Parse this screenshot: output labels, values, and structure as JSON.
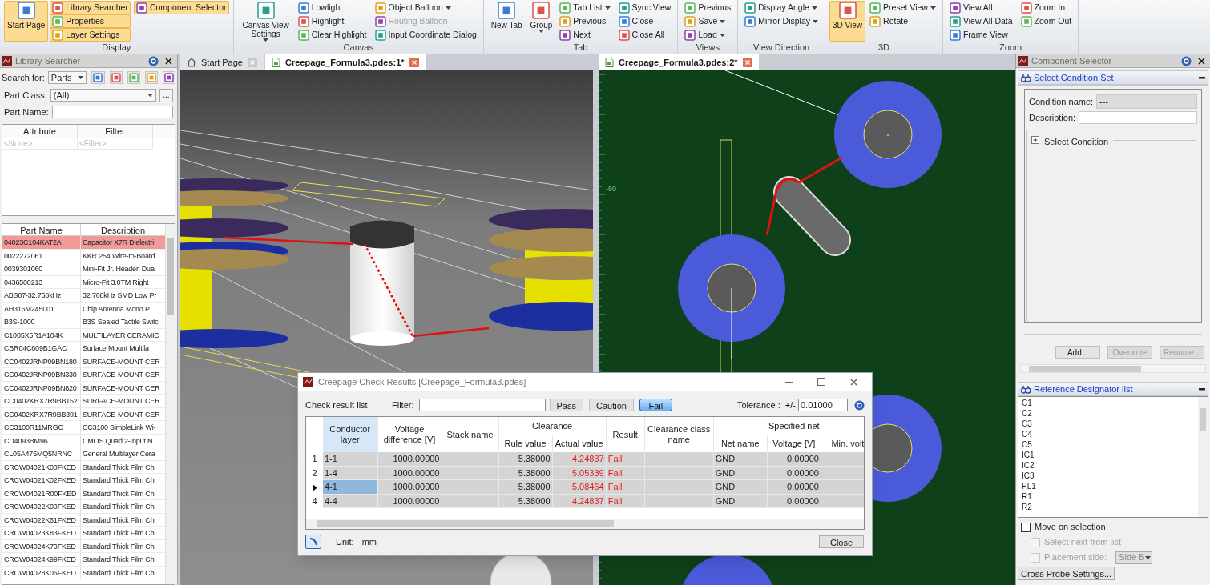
{
  "ribbon": {
    "groups": [
      {
        "label": "Display",
        "items": [
          {
            "label": "Start Page",
            "kind": "large",
            "on": true,
            "disabled": false,
            "dropdown": false
          },
          {
            "label": "Library Searcher",
            "kind": "small",
            "on": true,
            "disabled": false,
            "dropdown": false
          },
          {
            "label": "Properties",
            "kind": "small",
            "on": true,
            "disabled": false,
            "dropdown": false
          },
          {
            "label": "Layer Settings",
            "kind": "small",
            "on": true,
            "disabled": false,
            "dropdown": false
          },
          {
            "label": "Component Selector",
            "kind": "small",
            "on": true,
            "disabled": false,
            "dropdown": false
          }
        ]
      },
      {
        "label": "Canvas",
        "items": [
          {
            "label": "Canvas View Settings",
            "kind": "large",
            "on": false,
            "disabled": false,
            "dropdown": true
          },
          {
            "label": "Lowlight",
            "kind": "small",
            "on": false,
            "disabled": false,
            "dropdown": false
          },
          {
            "label": "Highlight",
            "kind": "small",
            "on": false,
            "disabled": false,
            "dropdown": false
          },
          {
            "label": "Clear Highlight",
            "kind": "small",
            "on": false,
            "disabled": false,
            "dropdown": false
          },
          {
            "label": "Object Balloon",
            "kind": "small",
            "on": false,
            "disabled": false,
            "dropdown": true
          },
          {
            "label": "Routing Balloon",
            "kind": "small",
            "on": false,
            "disabled": true,
            "dropdown": false
          },
          {
            "label": "Input Coordinate Dialog",
            "kind": "small",
            "on": false,
            "disabled": false,
            "dropdown": false
          }
        ]
      },
      {
        "label": "Tab",
        "items": [
          {
            "label": "New Tab",
            "kind": "large",
            "on": false,
            "disabled": false,
            "dropdown": false
          },
          {
            "label": "Group",
            "kind": "large",
            "on": false,
            "disabled": false,
            "dropdown": true
          },
          {
            "label": "Tab List",
            "kind": "small",
            "on": false,
            "disabled": false,
            "dropdown": true
          },
          {
            "label": "Previous",
            "kind": "small",
            "on": false,
            "disabled": false,
            "dropdown": false
          },
          {
            "label": "Next",
            "kind": "small",
            "on": false,
            "disabled": false,
            "dropdown": false
          },
          {
            "label": "Sync View",
            "kind": "small",
            "on": false,
            "disabled": false,
            "dropdown": false
          },
          {
            "label": "Close",
            "kind": "small",
            "on": false,
            "disabled": false,
            "dropdown": false
          },
          {
            "label": "Close All",
            "kind": "small",
            "on": false,
            "disabled": false,
            "dropdown": false
          }
        ]
      },
      {
        "label": "Views",
        "items": [
          {
            "label": "Previous",
            "kind": "small",
            "on": false,
            "disabled": false,
            "dropdown": false
          },
          {
            "label": "Save",
            "kind": "small",
            "on": false,
            "disabled": false,
            "dropdown": true
          },
          {
            "label": "Load",
            "kind": "small",
            "on": false,
            "disabled": false,
            "dropdown": true
          }
        ]
      },
      {
        "label": "View Direction",
        "items": [
          {
            "label": "Display Angle",
            "kind": "small",
            "on": false,
            "disabled": false,
            "dropdown": true
          },
          {
            "label": "Mirror Display",
            "kind": "small",
            "on": false,
            "disabled": false,
            "dropdown": true
          }
        ]
      },
      {
        "label": "3D",
        "items": [
          {
            "label": "3D View",
            "kind": "large",
            "on": true,
            "disabled": false,
            "dropdown": false
          },
          {
            "label": "Preset View",
            "kind": "small",
            "on": false,
            "disabled": false,
            "dropdown": true
          },
          {
            "label": "Rotate",
            "kind": "small",
            "on": false,
            "disabled": false,
            "dropdown": false
          }
        ]
      },
      {
        "label": "Zoom",
        "items": [
          {
            "label": "View All",
            "kind": "small",
            "on": false,
            "disabled": false,
            "dropdown": false
          },
          {
            "label": "View All Data",
            "kind": "small",
            "on": false,
            "disabled": false,
            "dropdown": false
          },
          {
            "label": "Frame View",
            "kind": "small",
            "on": false,
            "disabled": false,
            "dropdown": false
          },
          {
            "label": "Zoom In",
            "kind": "small",
            "on": false,
            "disabled": false,
            "dropdown": false
          },
          {
            "label": "Zoom Out",
            "kind": "small",
            "on": false,
            "disabled": false,
            "dropdown": false
          }
        ]
      }
    ]
  },
  "library_searcher": {
    "title": "Library Searcher",
    "search_for_label": "Search for:",
    "search_for_value": "Parts",
    "part_class_label": "Part Class:",
    "part_class_value": "(All)",
    "part_class_button": "...",
    "part_name_label": "Part Name:",
    "attribute_table": {
      "columns": [
        "Attribute",
        "Filter"
      ],
      "placeholders": [
        "<None>",
        "<Filter>"
      ]
    },
    "parts_table": {
      "columns": [
        "Part Name",
        "Description"
      ],
      "rows": [
        {
          "part_name": "04023C104KAT2A",
          "description": "Capacitor X7R Dielectri",
          "selected": true
        },
        {
          "part_name": "0022272061",
          "description": "KKR 254 Wire-to-Board",
          "selected": false
        },
        {
          "part_name": "0039301060",
          "description": "Mini-Fit Jr. Header, Dua",
          "selected": false
        },
        {
          "part_name": "0436500213",
          "description": "Micro-Fit 3.0TM Right",
          "selected": false
        },
        {
          "part_name": "ABS07-32.768kHz",
          "description": "32.768kHz SMD Low Pr",
          "selected": false
        },
        {
          "part_name": "AH316M245001",
          "description": "Chip Antenna Mono P",
          "selected": false
        },
        {
          "part_name": "B3S-1000",
          "description": "B3S Sealed Tactile Switc",
          "selected": false
        },
        {
          "part_name": "C1005X5R1A104K",
          "description": "MULTILAYER CERAMIC",
          "selected": false
        },
        {
          "part_name": "CBR04C609B1GAC",
          "description": "Surface Mount Multila",
          "selected": false
        },
        {
          "part_name": "CC0402JRNP09BN180",
          "description": "SURFACE-MOUNT CER",
          "selected": false
        },
        {
          "part_name": "CC0402JRNP09BN330",
          "description": "SURFACE-MOUNT CER",
          "selected": false
        },
        {
          "part_name": "CC0402JRNP09BN820",
          "description": "SURFACE-MOUNT CER",
          "selected": false
        },
        {
          "part_name": "CC0402KRX7R9BB152",
          "description": "SURFACE-MOUNT CER",
          "selected": false
        },
        {
          "part_name": "CC0402KRX7R9BB391",
          "description": "SURFACE-MOUNT CER",
          "selected": false
        },
        {
          "part_name": "CC3100R11MRGC",
          "description": "CC3100 SimpleLink Wi-",
          "selected": false
        },
        {
          "part_name": "CD4093BM96",
          "description": "CMOS Quad 2-Input N",
          "selected": false
        },
        {
          "part_name": "CL05A475MQ5NRNC",
          "description": "General Multilayer Cera",
          "selected": false
        },
        {
          "part_name": "CRCW04021K00FKED",
          "description": "Standard Thick Film Ch",
          "selected": false
        },
        {
          "part_name": "CRCW04021K02FKED",
          "description": "Standard Thick Film Ch",
          "selected": false
        },
        {
          "part_name": "CRCW04021R00FKED",
          "description": "Standard Thick Film Ch",
          "selected": false
        },
        {
          "part_name": "CRCW04022K00FKED",
          "description": "Standard Thick Film Ch",
          "selected": false
        },
        {
          "part_name": "CRCW04022K61FKED",
          "description": "Standard Thick Film Ch",
          "selected": false
        },
        {
          "part_name": "CRCW04023K83FKED",
          "description": "Standard Thick Film Ch",
          "selected": false
        },
        {
          "part_name": "CRCW04024K70FKED",
          "description": "Standard Thick Film Ch",
          "selected": false
        },
        {
          "part_name": "CRCW04024K99FKED",
          "description": "Standard Thick Film Ch",
          "selected": false
        },
        {
          "part_name": "CRCW04028K06FKED",
          "description": "Standard Thick Film Ch",
          "selected": false
        }
      ]
    }
  },
  "panes": [
    {
      "tabs": [
        {
          "label": "Start Page",
          "selected": false,
          "kind": "home"
        },
        {
          "label": "Creepage_Formula3.pdes:1*",
          "selected": true,
          "kind": "document"
        }
      ],
      "kind": "model"
    },
    {
      "tabs": [
        {
          "label": "Creepage_Formula3.pdes:2*",
          "selected": true,
          "kind": "document"
        }
      ],
      "kind": "pcb",
      "ruler_label": "-80"
    }
  ],
  "component_selector": {
    "title": "Component Selector",
    "condition_set": {
      "title": "Select Condition Set",
      "condition_name_label": "Condition name:",
      "condition_name_value": "---",
      "description_label": "Description:",
      "select_condition": "Select Condition",
      "buttons": [
        {
          "label": "Add...",
          "disabled": false
        },
        {
          "label": "Overwrite",
          "disabled": true
        },
        {
          "label": "Rename...",
          "disabled": true
        }
      ]
    },
    "reference_designators": {
      "title": "Reference Designator list",
      "items": [
        "C1",
        "C2",
        "C3",
        "C4",
        "C5",
        "IC1",
        "IC2",
        "IC3",
        "PL1",
        "R1",
        "R2"
      ]
    },
    "options": [
      {
        "label": "Move on selection",
        "checked": false,
        "disabled": false
      },
      {
        "label": "Select next from list",
        "checked": false,
        "disabled": true
      },
      {
        "label": "Placement side:",
        "checked": false,
        "disabled": true
      }
    ],
    "placement_side_value": "Side B",
    "cross_probe_button": "Cross Probe Settings..."
  },
  "dialog": {
    "title": "Creepage Check Results [Creepage_Formula3.pdes]",
    "list_label": "Check result list",
    "filter_label": "Filter:",
    "filter_buttons": [
      {
        "label": "Pass",
        "selected": false
      },
      {
        "label": "Caution",
        "selected": false
      },
      {
        "label": "Fail",
        "selected": true
      }
    ],
    "tolerance_label": "Tolerance :  +/-",
    "tolerance_value": "0.01000",
    "headers": [
      {
        "label": "Conductor layer",
        "selected": true
      },
      {
        "label": "Voltage difference [V]",
        "selected": false
      },
      {
        "label": "Stack name",
        "selected": false
      },
      {
        "label": "Clearance",
        "selected": false,
        "columns": [
          "Rule value",
          "Actual value"
        ]
      },
      {
        "label": "Result",
        "selected": false
      },
      {
        "label": "Clearance class name",
        "selected": false
      },
      {
        "label": "Specified net",
        "selected": false,
        "columns": [
          "Net name",
          "Voltage [V]",
          "Min. volt"
        ]
      }
    ],
    "rows": [
      {
        "number": "1",
        "selected": false,
        "failed": true,
        "conductor_layer": "1-1",
        "voltage_difference": "1000.00000",
        "rule_value": "5.38000",
        "actual_value": "4.24837",
        "result": "Fail",
        "net_name": "GND",
        "voltage": "0.00000"
      },
      {
        "number": "2",
        "selected": false,
        "failed": true,
        "conductor_layer": "1-4",
        "voltage_difference": "1000.00000",
        "rule_value": "5.38000",
        "actual_value": "5.05339",
        "result": "Fail",
        "net_name": "GND",
        "voltage": "0.00000"
      },
      {
        "selected": true,
        "failed": true,
        "conductor_layer": "4-1",
        "voltage_difference": "1000.00000",
        "rule_value": "5.38000",
        "actual_value": "5.08464",
        "result": "Fail",
        "net_name": "GND",
        "voltage": "0.00000"
      },
      {
        "number": "4",
        "selected": false,
        "failed": true,
        "conductor_layer": "4-4",
        "voltage_difference": "1000.00000",
        "rule_value": "5.38000",
        "actual_value": "4.24837",
        "result": "Fail",
        "net_name": "GND",
        "voltage": "0.00000"
      }
    ],
    "unit_label": "Unit:",
    "unit_value": "mm",
    "close_button": "Close"
  }
}
